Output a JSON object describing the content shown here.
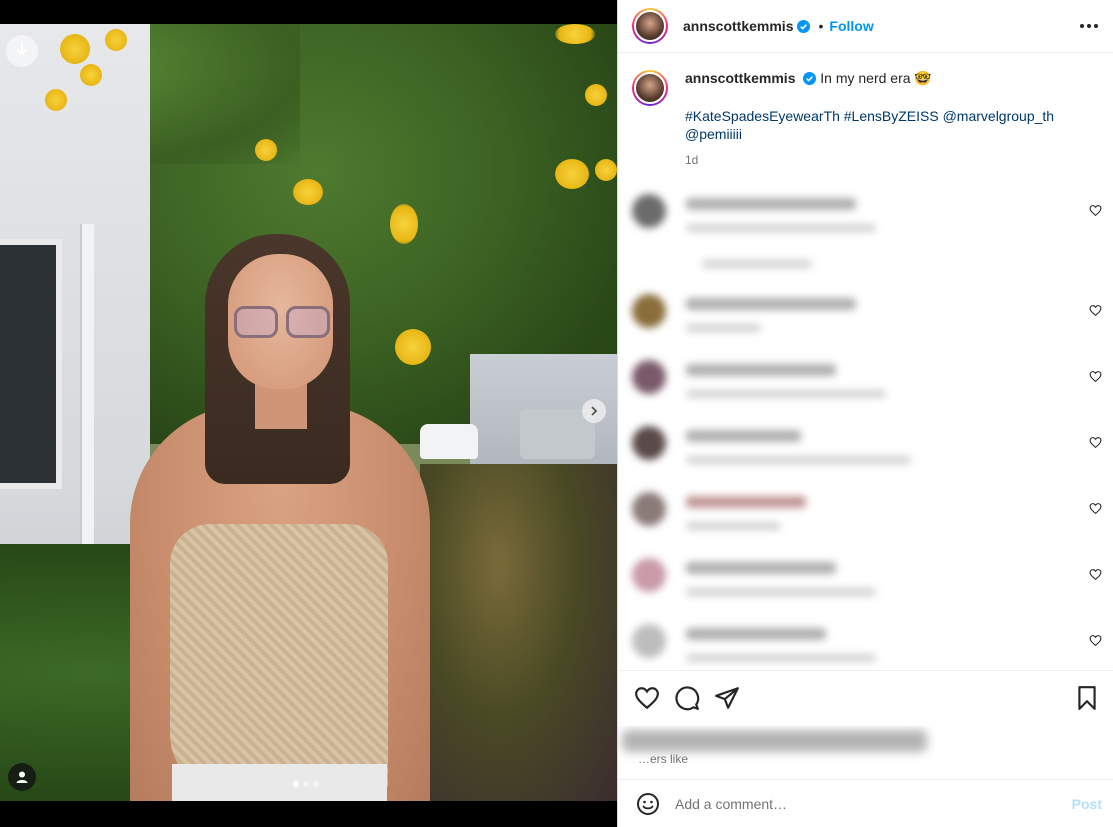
{
  "post": {
    "username": "annscottkemmis",
    "follow_label": "Follow",
    "separator": "•",
    "caption_text": "In my nerd era",
    "caption_tags": "#KateSpadesEyewearTh #LensByZEISS @marvelgroup_th @pemiiiii",
    "time": "1d",
    "emoji": "🤓"
  },
  "liked_by": {
    "fragment": "…ers like"
  },
  "add_comment": {
    "placeholder": "Add a comment…",
    "post_label": "Post"
  },
  "colors": {
    "accent": "#0095f6",
    "link": "#00376b",
    "post_disabled": "#b2dffc"
  },
  "icons": {
    "download": "download-icon",
    "next": "chevron-right-icon",
    "user": "user-tag-icon",
    "more": "more-horizontal-icon",
    "heart": "heart-icon",
    "comment": "comment-icon",
    "share": "share-icon",
    "save": "bookmark-icon",
    "emoji": "emoji-icon"
  }
}
